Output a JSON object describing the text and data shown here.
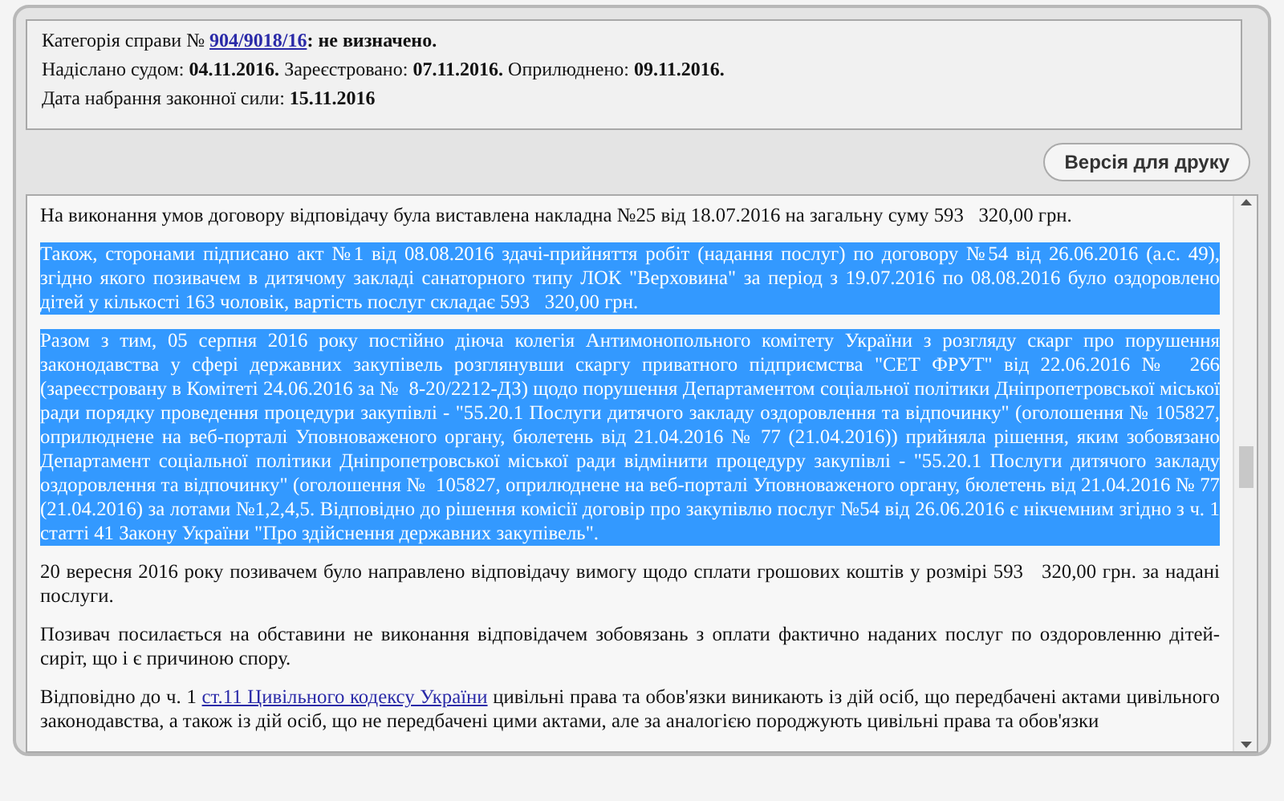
{
  "case_info": [
    {
      "parts": [
        {
          "kind": "text",
          "text": "Категорія справи № "
        },
        {
          "kind": "link",
          "text": "904/9018/16"
        },
        {
          "kind": "bold",
          "text": ": не визначено."
        }
      ]
    },
    {
      "parts": [
        {
          "kind": "text",
          "text": "Надіслано судом: "
        },
        {
          "kind": "bold",
          "text": "04.11.2016."
        },
        {
          "kind": "text",
          "text": " Зареєстровано: "
        },
        {
          "kind": "bold",
          "text": "07.11.2016."
        },
        {
          "kind": "text",
          "text": " Оприлюднено: "
        },
        {
          "kind": "bold",
          "text": "09.11.2016."
        }
      ]
    },
    {
      "parts": [
        {
          "kind": "text",
          "text": "Дата набрання законної сили: "
        },
        {
          "kind": "bold",
          "text": "15.11.2016"
        }
      ]
    }
  ],
  "print_button": "Версія для друку",
  "document": [
    {
      "selected": false,
      "parts": [
        {
          "kind": "text",
          "text": "На виконання умов договору відповідачу була виставлена накладна №25 від 18.07.2016 на загальну суму 593   320,00 грн."
        }
      ]
    },
    {
      "selected": true,
      "parts": [
        {
          "kind": "text",
          "text": "Також, сторонами підписано акт №1 від 08.08.2016 здачі-прийняття робіт (надання послуг) по договору №54 від 26.06.2016 (а.с. 49), згідно якого позивачем в дитячому закладі санаторного типу ЛОК \"Верховина\" за період з 19.07.2016 по 08.08.2016 було оздоровлено дітей у кількості 163 чоловік, вартість послуг складає 593   320,00 грн."
        }
      ]
    },
    {
      "selected": true,
      "parts": [
        {
          "kind": "text",
          "text": "Разом з тим, 05 серпня 2016 року постійно діюча колегія Антимонопольного комітету України з розгляду скарг про порушення законодавства у сфері державних закупівель розглянувши скаргу приватного підприємства \"СЕТ ФРУТ\" від 22.06.2016 №  266 (зареєстровану в Комітеті 24.06.2016 за №  8-20/2212-ДЗ) щодо порушення Департаментом соціальної політики Дніпропетровської міської ради порядку проведення процедури закупівлі - \"55.20.1 Послуги дитячого закладу оздоровлення та відпочинку\" (оголошення № 105827, оприлюднене на веб-порталі Уповноваженого органу, бюлетень від 21.04.2016 № 77 (21.04.2016)) прийняла рішення, яким зобовязано Департамент соціальної політики Дніпропетровської міської ради відмінити процедуру закупівлі - \"55.20.1 Послуги дитячого закладу оздоровлення та відпочинку\" (оголошення №  105827, оприлюднене на веб-порталі Уповноваженого органу, бюлетень від 21.04.2016 № 77 (21.04.2016) за лотами №1,2,4,5. Відповідно до рішення комісії договір про закупівлю послуг №54 від 26.06.2016 є нікчемним згідно з ч. 1 статті 41 Закону України \"Про здійснення державних закупівель\"."
        }
      ]
    },
    {
      "selected": false,
      "parts": [
        {
          "kind": "text",
          "text": "20 вересня 2016 року позивачем було направлено відповідачу вимогу щодо сплати грошових коштів у розмірі 593   320,00 грн. за надані послуги."
        }
      ]
    },
    {
      "selected": false,
      "parts": [
        {
          "kind": "text",
          "text": "Позивач посилається на обставини не виконання відповідачем зобовязань з оплати фактично наданих послуг по оздоровленню дітей-сиріт, що і є причиною спору."
        }
      ]
    },
    {
      "selected": false,
      "parts": [
        {
          "kind": "text",
          "text": "Відповідно до ч. 1 "
        },
        {
          "kind": "link",
          "text": "ст.11 Цивільного кодексу України"
        },
        {
          "kind": "text",
          "text": " цивільні права та обов'язки виникають із дій осіб, що передбачені актами цивільного законодавства, а також із дій осіб, що не передбачені цими актами, але за аналогією породжують цивільні права та обов'язки"
        }
      ]
    }
  ]
}
